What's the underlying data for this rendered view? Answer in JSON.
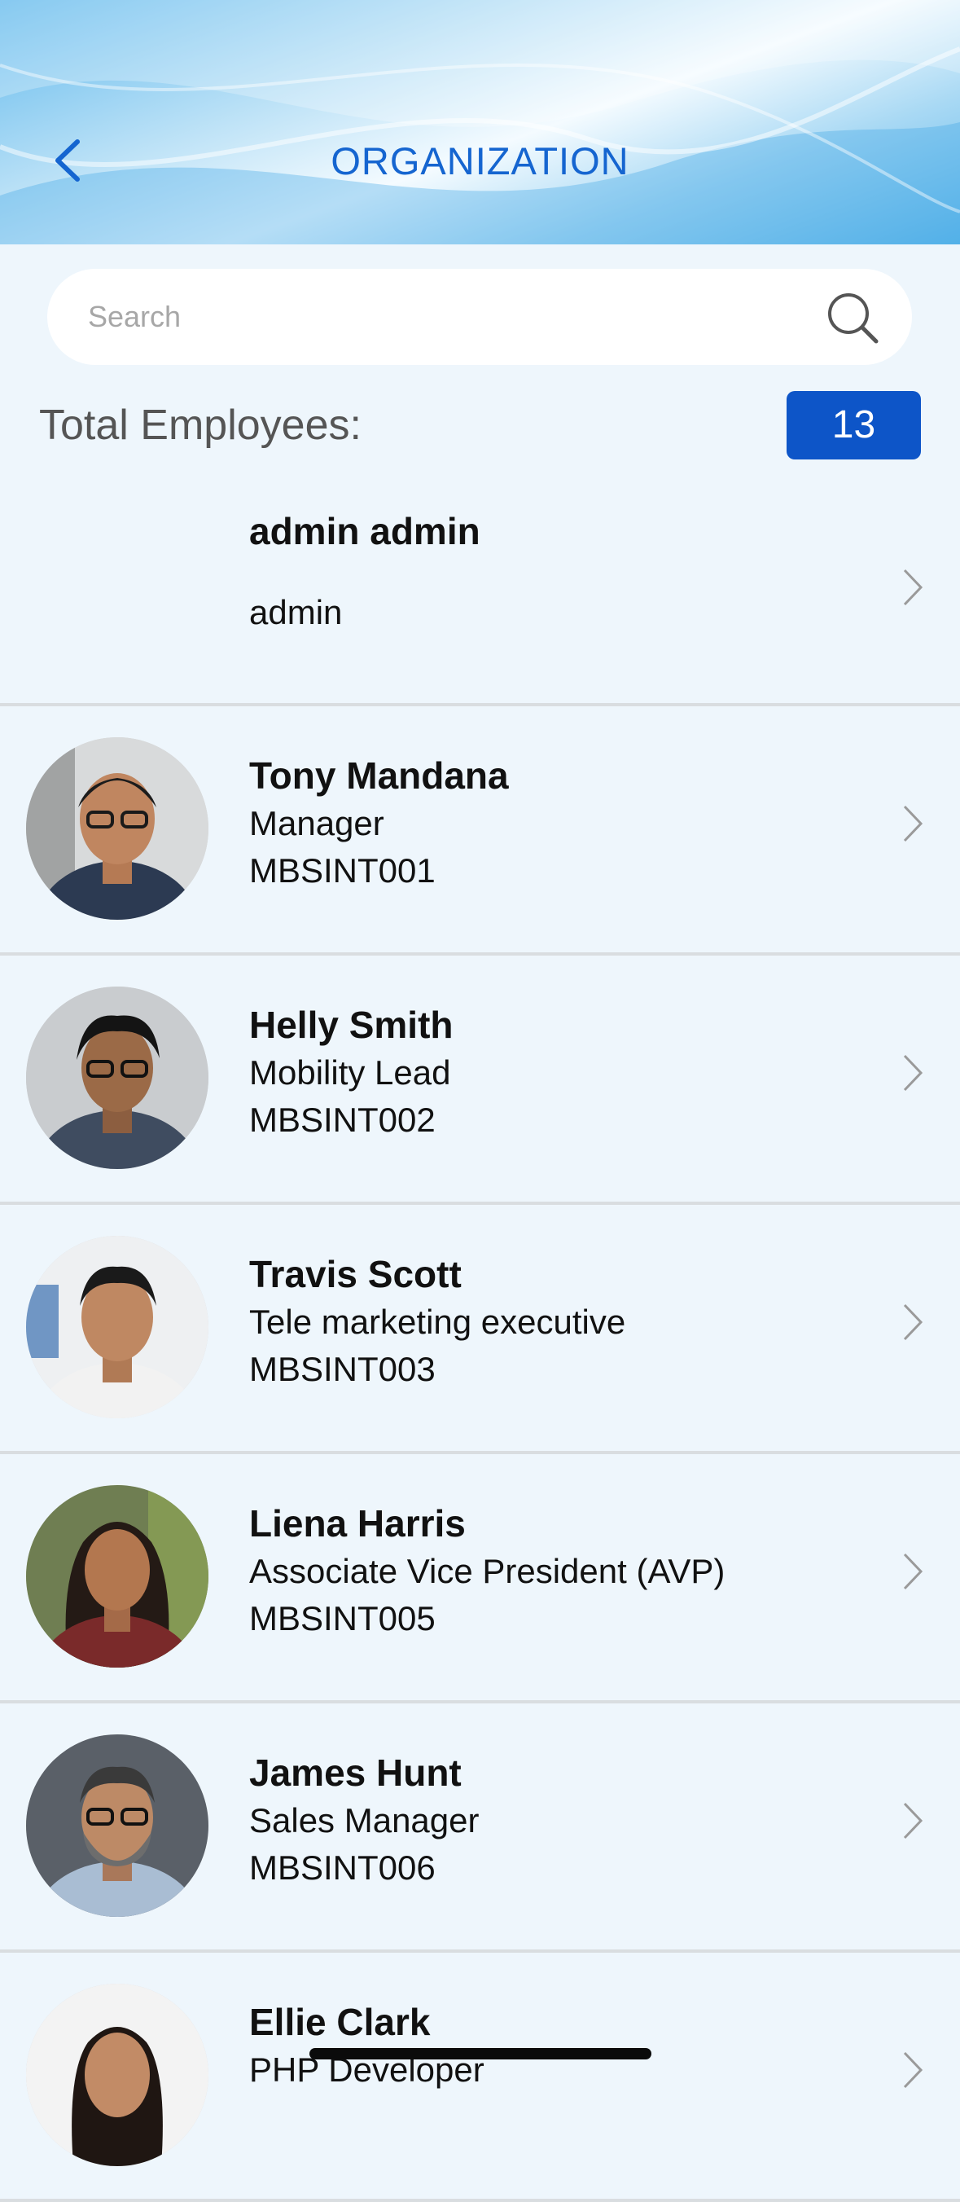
{
  "header": {
    "title": "ORGANIZATION",
    "back_icon": "chevron-left-icon",
    "accent_color": "#1565d0"
  },
  "search": {
    "placeholder": "Search",
    "icon": "search-icon"
  },
  "summary": {
    "total_label": "Total Employees:",
    "total_count": "13",
    "badge_color": "#0d55c8"
  },
  "employees": [
    {
      "name": "admin admin",
      "designation": "admin",
      "code": "",
      "avatar": "none"
    },
    {
      "name": "Tony Mandana",
      "designation": "Manager",
      "code": "MBSINT001",
      "avatar": "photo"
    },
    {
      "name": "Helly Smith",
      "designation": "Mobility Lead",
      "code": "MBSINT002",
      "avatar": "photo"
    },
    {
      "name": "Travis Scott",
      "designation": "Tele marketing executive",
      "code": "MBSINT003",
      "avatar": "photo"
    },
    {
      "name": "Liena Harris",
      "designation": "Associate Vice President (AVP)",
      "code": "MBSINT005",
      "avatar": "photo"
    },
    {
      "name": "James Hunt",
      "designation": "Sales Manager",
      "code": "MBSINT006",
      "avatar": "photo"
    },
    {
      "name": "Ellie Clark",
      "designation": "PHP Developer",
      "code": "",
      "avatar": "photo"
    }
  ],
  "row_icon": "chevron-right-icon"
}
